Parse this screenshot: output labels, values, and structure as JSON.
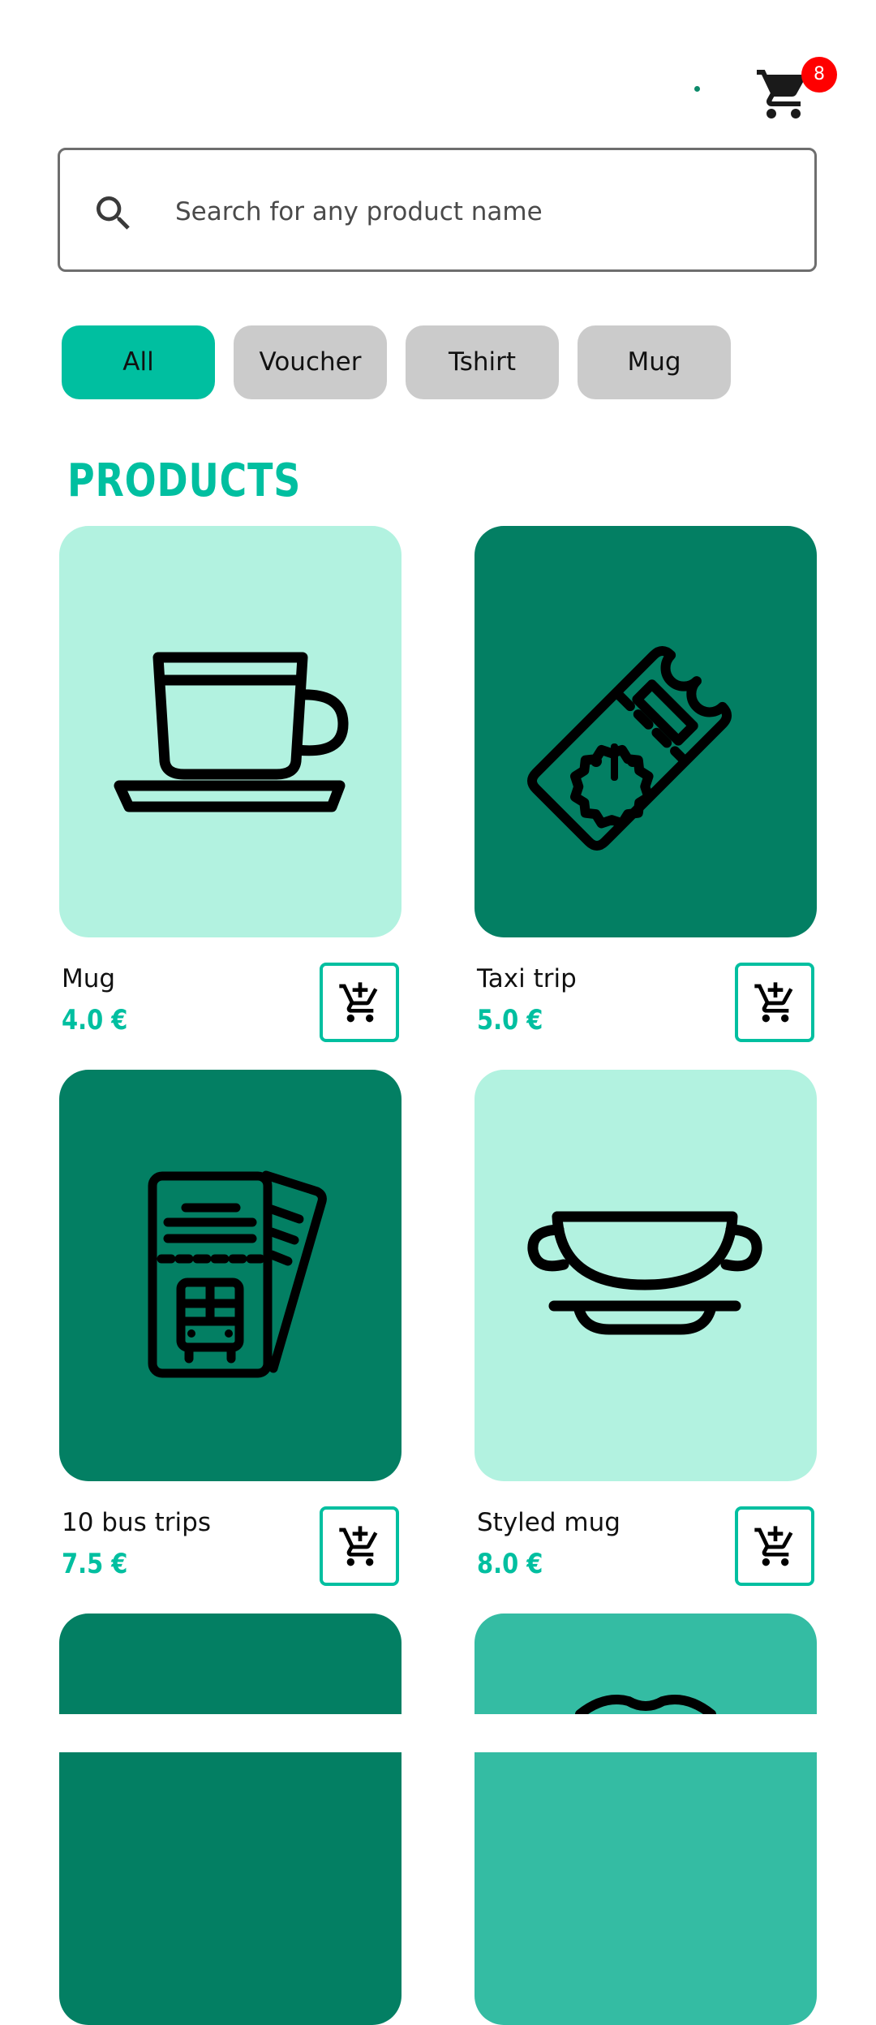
{
  "header": {
    "cart_count": "8",
    "cart_icon": "shopping-cart-icon"
  },
  "search": {
    "placeholder": "Search for any product name",
    "icon": "search-icon"
  },
  "categories": [
    {
      "label": "All",
      "active": true
    },
    {
      "label": "Voucher",
      "active": false
    },
    {
      "label": "Tshirt",
      "active": false
    },
    {
      "label": "Mug",
      "active": false
    }
  ],
  "section_title": "PRODUCTS",
  "colors": {
    "accent": "#00bfa0",
    "light_card": "#b2f2e0",
    "dark_card": "#037f63",
    "mid_card": "#34bca3",
    "chip_inactive": "#cbcbcb",
    "badge": "#ff0000"
  },
  "products": [
    {
      "name": "Mug",
      "price": "4.0 €",
      "icon": "mug-icon",
      "bg": "#b2f2e0"
    },
    {
      "name": "Taxi trip",
      "price": "5.0 €",
      "icon": "ticket-voucher-icon",
      "bg": "#037f63"
    },
    {
      "name": "10 bus trips",
      "price": "7.5 €",
      "icon": "bus-ticket-icon",
      "bg": "#037f63"
    },
    {
      "name": "Styled mug",
      "price": "8.0 €",
      "icon": "bowl-cup-icon",
      "bg": "#b2f2e0"
    },
    {
      "name": "",
      "price": "",
      "icon": "",
      "bg": "#037f63"
    },
    {
      "name": "",
      "price": "",
      "icon": "tshirt-icon",
      "bg": "#34bca3"
    }
  ],
  "add_to_cart_icon": "add-to-cart-icon"
}
